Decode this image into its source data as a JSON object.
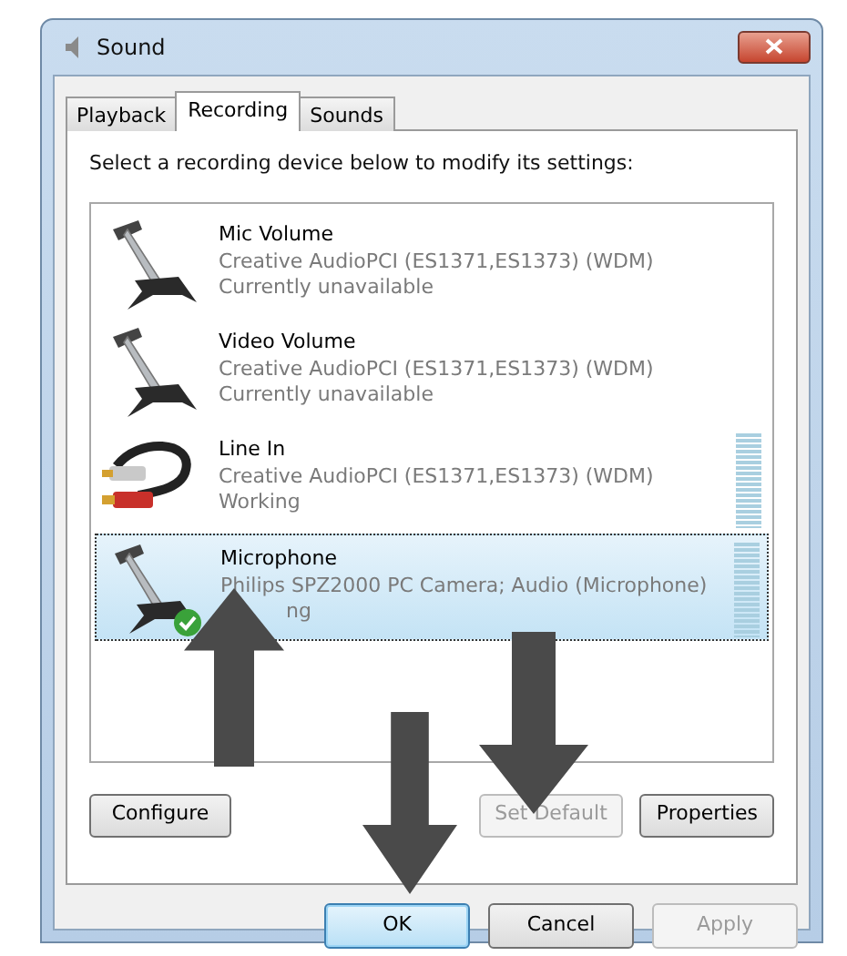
{
  "window": {
    "title": "Sound"
  },
  "tabs": [
    {
      "label": "Playback",
      "selected": false
    },
    {
      "label": "Recording",
      "selected": true
    },
    {
      "label": "Sounds",
      "selected": false
    }
  ],
  "instruction": "Select a recording device below to modify its settings:",
  "devices": [
    {
      "kind": "microphone",
      "name": "Mic Volume",
      "driver": "Creative AudioPCI (ES1371,ES1373) (WDM)",
      "status": "Currently unavailable",
      "selected": false,
      "default": false,
      "meter": false
    },
    {
      "kind": "microphone",
      "name": "Video Volume",
      "driver": "Creative AudioPCI (ES1371,ES1373) (WDM)",
      "status": "Currently unavailable",
      "selected": false,
      "default": false,
      "meter": false
    },
    {
      "kind": "cable",
      "name": "Line In",
      "driver": "Creative AudioPCI (ES1371,ES1373) (WDM)",
      "status": "Working",
      "selected": false,
      "default": false,
      "meter": true
    },
    {
      "kind": "microphone",
      "name": "Microphone",
      "driver": "Philips SPZ2000 PC Camera; Audio (Microphone)",
      "status": "ng",
      "selected": true,
      "default": true,
      "meter": true
    }
  ],
  "panel_buttons": [
    {
      "label": "Configure",
      "disabled": false
    },
    {
      "label": "Set Default",
      "disabled": true
    },
    {
      "label": "Properties",
      "disabled": false
    }
  ],
  "dialog_buttons": [
    {
      "label": "OK",
      "disabled": false,
      "focused": true
    },
    {
      "label": "Cancel",
      "disabled": false,
      "focused": false
    },
    {
      "label": "Apply",
      "disabled": true,
      "focused": false
    }
  ],
  "arrows": [
    {
      "kind": "up"
    },
    {
      "kind": "down"
    },
    {
      "kind": "down"
    }
  ]
}
